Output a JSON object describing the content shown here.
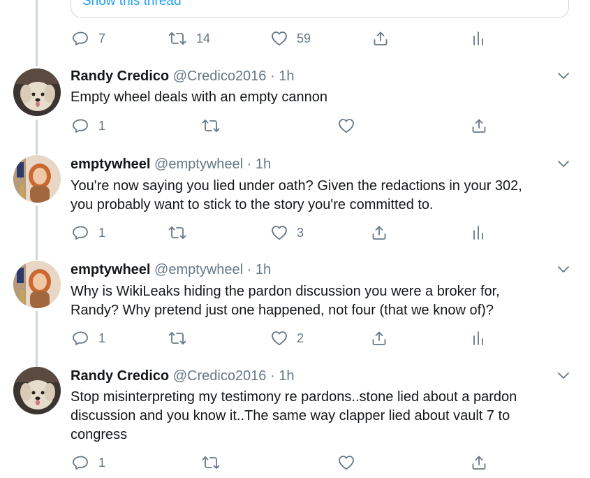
{
  "colors": {
    "accent": "#1da1f2",
    "text": "#14171a",
    "muted": "#657786",
    "border": "#ccd6dd"
  },
  "top": {
    "show_thread_label": "Show this thread",
    "actions": {
      "reply": "7",
      "retweet": "14",
      "like": "59"
    }
  },
  "tweets": [
    {
      "name": "Randy Credico",
      "handle": "@Credico2016",
      "time": "1h",
      "avatar_icon": "dog-avatar",
      "lines": [
        "Empty wheel deals with an empty cannon"
      ],
      "actions": {
        "reply": "1",
        "retweet": "",
        "like": ""
      }
    },
    {
      "name": "emptywheel",
      "handle": "@emptywheel",
      "time": "1h",
      "avatar_icon": "woman-avatar",
      "lines": [
        "You're now saying you lied under oath? Given the redactions in your 302,",
        "you probably want to stick to the story you're committed to."
      ],
      "actions": {
        "reply": "1",
        "retweet": "",
        "like": "3"
      }
    },
    {
      "name": "emptywheel",
      "handle": "@emptywheel",
      "time": "1h",
      "avatar_icon": "woman-avatar",
      "lines": [
        "Why is WikiLeaks hiding the pardon discussion you were a broker for,",
        "Randy? Why pretend just one happened, not four (that we know of)?"
      ],
      "actions": {
        "reply": "1",
        "retweet": "",
        "like": "2"
      }
    },
    {
      "name": "Randy Credico",
      "handle": "@Credico2016",
      "time": "1h",
      "avatar_icon": "dog-avatar",
      "lines": [
        "Stop misinterpreting my testimony re pardons..stone lied about a pardon",
        "discussion and you know it..The same way clapper lied about  vault 7 to",
        "congress"
      ],
      "actions": {
        "reply": "1",
        "retweet": "",
        "like": ""
      }
    }
  ]
}
